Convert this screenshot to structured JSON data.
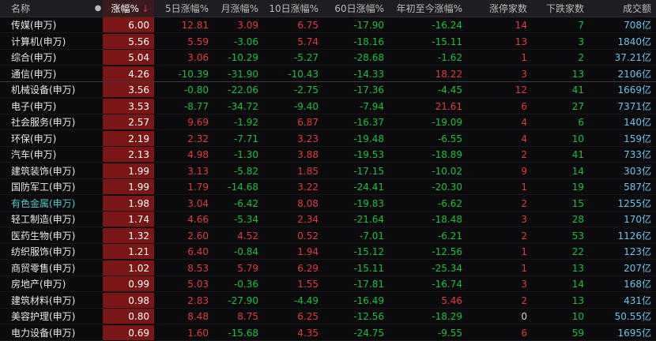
{
  "colors": {
    "up": "#e23a3a",
    "down": "#17c238",
    "flat": "#d6d6d6",
    "amount": "#6cc4ea",
    "name": "#e8e8e8",
    "highlight_name": "#4ec7c7"
  },
  "header": {
    "name": "名称",
    "dot": "●",
    "change": "涨幅%",
    "sort_arrow": "↓",
    "d5": "5日涨幅%",
    "month": "月涨幅%",
    "d10": "10日涨幅%",
    "d60": "60日涨幅%",
    "ytd": "年初至今涨幅%",
    "up_count": "涨停家数",
    "down_count": "下跌家数",
    "amount": "成交额"
  },
  "rows": [
    {
      "name": "传媒(申万)",
      "change": "6.00",
      "d5": "12.81",
      "month": "3.09",
      "d10": "6.75",
      "d60": "-17.90",
      "ytd": "-16.24",
      "up": "14",
      "down": "7",
      "amount": "708亿"
    },
    {
      "name": "计算机(申万)",
      "change": "5.56",
      "d5": "5.59",
      "month": "-3.06",
      "d10": "5.74",
      "d60": "-18.16",
      "ytd": "-15.11",
      "up": "13",
      "down": "3",
      "amount": "1840亿"
    },
    {
      "name": "综合(申万)",
      "change": "5.04",
      "d5": "3.06",
      "month": "-10.29",
      "d10": "-5.27",
      "d60": "-28.68",
      "ytd": "-1.62",
      "up": "1",
      "down": "2",
      "amount": "37.21亿"
    },
    {
      "name": "通信(申万)",
      "change": "4.26",
      "d5": "-10.39",
      "month": "-31.90",
      "d10": "-10.43",
      "d60": "-14.33",
      "ytd": "18.22",
      "up": "3",
      "down": "13",
      "amount": "2106亿"
    },
    {
      "name": "机械设备(申万)",
      "change": "3.56",
      "d5": "-0.80",
      "month": "-22.06",
      "d10": "-2.75",
      "d60": "-17.36",
      "ytd": "-4.45",
      "up": "12",
      "down": "41",
      "amount": "1669亿"
    },
    {
      "name": "电子(申万)",
      "change": "3.53",
      "d5": "-8.77",
      "month": "-34.72",
      "d10": "-9.40",
      "d60": "-7.94",
      "ytd": "21.61",
      "up": "6",
      "down": "27",
      "amount": "7371亿"
    },
    {
      "name": "社会服务(申万)",
      "change": "2.57",
      "d5": "9.69",
      "month": "-1.92",
      "d10": "6.87",
      "d60": "-16.37",
      "ytd": "-19.09",
      "up": "4",
      "down": "6",
      "amount": "140亿"
    },
    {
      "name": "环保(申万)",
      "change": "2.19",
      "d5": "2.32",
      "month": "-7.71",
      "d10": "3.23",
      "d60": "-19.48",
      "ytd": "-6.55",
      "up": "4",
      "down": "10",
      "amount": "159亿"
    },
    {
      "name": "汽车(申万)",
      "change": "2.13",
      "d5": "4.98",
      "month": "-1.30",
      "d10": "3.88",
      "d60": "-19.53",
      "ytd": "-18.89",
      "up": "2",
      "down": "41",
      "amount": "733亿"
    },
    {
      "name": "建筑装饰(申万)",
      "change": "1.99",
      "d5": "3.13",
      "month": "-5.82",
      "d10": "1.85",
      "d60": "-17.15",
      "ytd": "-10.02",
      "up": "9",
      "down": "14",
      "amount": "303亿"
    },
    {
      "name": "国防军工(申万)",
      "change": "1.99",
      "d5": "1.79",
      "month": "-14.68",
      "d10": "3.22",
      "d60": "-24.41",
      "ytd": "-20.30",
      "up": "1",
      "down": "19",
      "amount": "587亿"
    },
    {
      "name": "有色金属(申万)",
      "change": "1.98",
      "d5": "3.04",
      "month": "-6.42",
      "d10": "8.08",
      "d60": "-19.83",
      "ytd": "-6.62",
      "up": "2",
      "down": "15",
      "amount": "1255亿",
      "highlight": true
    },
    {
      "name": "轻工制造(申万)",
      "change": "1.74",
      "d5": "4.66",
      "month": "-5.34",
      "d10": "2.34",
      "d60": "-21.64",
      "ytd": "-18.48",
      "up": "3",
      "down": "28",
      "amount": "170亿"
    },
    {
      "name": "医药生物(申万)",
      "change": "1.32",
      "d5": "2.60",
      "month": "4.52",
      "d10": "0.52",
      "d60": "-7.01",
      "ytd": "-6.21",
      "up": "2",
      "down": "53",
      "amount": "1126亿"
    },
    {
      "name": "纺织服饰(申万)",
      "change": "1.21",
      "d5": "6.40",
      "month": "-0.84",
      "d10": "1.94",
      "d60": "-15.12",
      "ytd": "-12.56",
      "up": "1",
      "down": "22",
      "amount": "123亿"
    },
    {
      "name": "商贸零售(申万)",
      "change": "1.02",
      "d5": "8.53",
      "month": "5.79",
      "d10": "6.29",
      "d60": "-15.11",
      "ytd": "-25.34",
      "up": "1",
      "down": "13",
      "amount": "207亿"
    },
    {
      "name": "房地产(申万)",
      "change": "0.99",
      "d5": "5.03",
      "month": "-0.36",
      "d10": "1.55",
      "d60": "-17.81",
      "ytd": "-16.74",
      "up": "3",
      "down": "14",
      "amount": "168亿"
    },
    {
      "name": "建筑材料(申万)",
      "change": "0.98",
      "d5": "2.83",
      "month": "-27.90",
      "d10": "-4.49",
      "d60": "-16.49",
      "ytd": "5.46",
      "up": "2",
      "down": "13",
      "amount": "431亿"
    },
    {
      "name": "美容护理(申万)",
      "change": "0.80",
      "d5": "8.48",
      "month": "8.75",
      "d10": "6.25",
      "d60": "-12.56",
      "ytd": "-18.29",
      "up": "0",
      "down": "10",
      "amount": "50.55亿"
    },
    {
      "name": "电力设备(申万)",
      "change": "0.69",
      "d5": "1.60",
      "month": "-15.68",
      "d10": "4.35",
      "d60": "-24.75",
      "ytd": "-9.55",
      "up": "6",
      "down": "59",
      "amount": "1695亿"
    }
  ]
}
